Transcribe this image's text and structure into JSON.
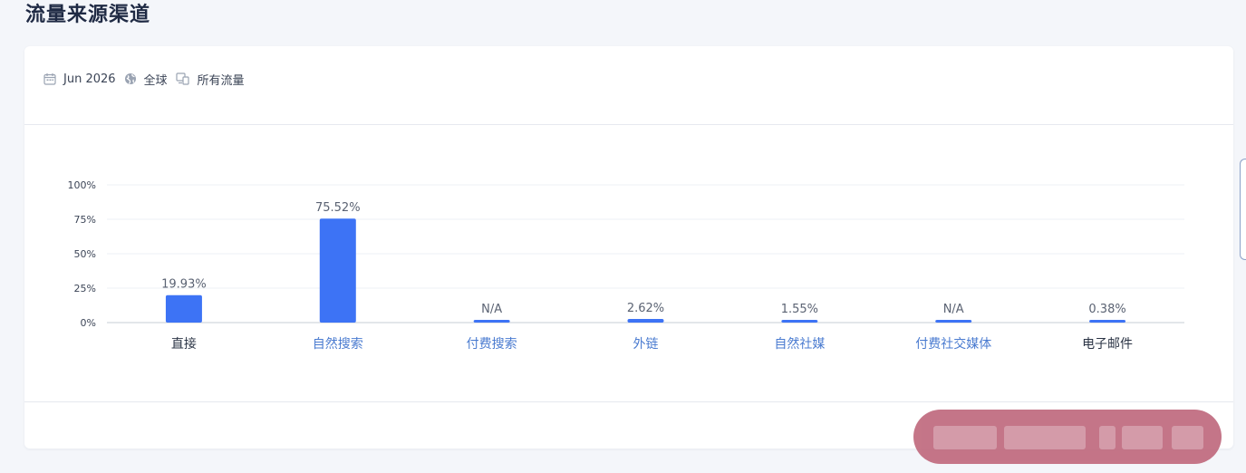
{
  "page": {
    "title": "流量来源渠道"
  },
  "filters": {
    "date": "Jun 2026",
    "region": "全球",
    "traffic": "所有流量",
    "date_icon": "calendar-icon",
    "region_icon": "globe-icon",
    "traffic_icon": "devices-icon"
  },
  "colors": {
    "bar": "#3d73f5",
    "link_label": "#4a7bd0",
    "plain_label": "#2b3445",
    "grid": "#edf0f5"
  },
  "chart_data": {
    "type": "bar",
    "categories": [
      "直接",
      "自然搜索",
      "付费搜索",
      "外链",
      "自然社媒",
      "付费社交媒体",
      "电子邮件"
    ],
    "values": [
      19.93,
      75.52,
      null,
      2.62,
      1.55,
      null,
      0.38
    ],
    "value_labels": [
      "19.93%",
      "75.52%",
      "N/A",
      "2.62%",
      "1.55%",
      "N/A",
      "0.38%"
    ],
    "category_is_link": [
      false,
      true,
      true,
      true,
      true,
      true,
      false
    ],
    "yticks": [
      "0%",
      "25%",
      "50%",
      "75%",
      "100%"
    ],
    "ylim": [
      0,
      100
    ],
    "grid": true,
    "legend": "none"
  }
}
